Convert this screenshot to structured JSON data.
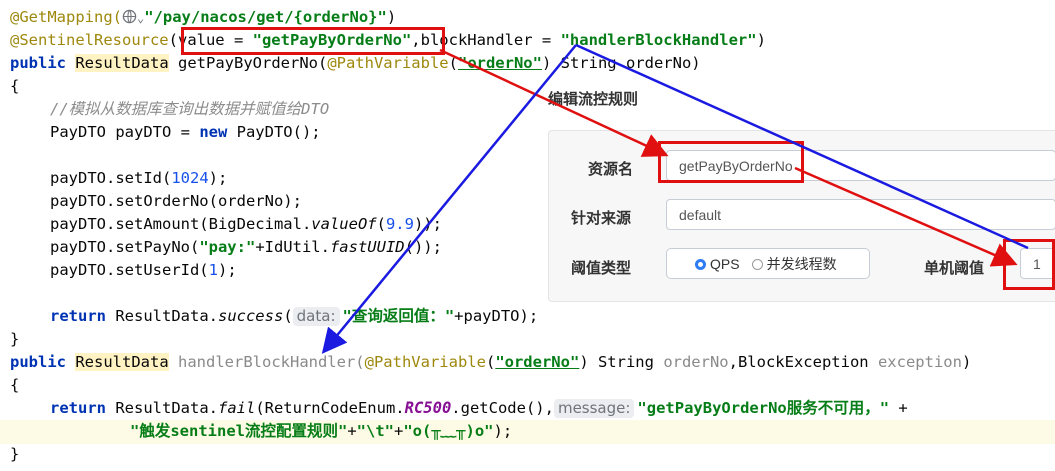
{
  "code": {
    "l1": {
      "annotation": "@GetMapping(",
      "path": "\"/pay/nacos/get/{orderNo}\"",
      "close": ")"
    },
    "l2": {
      "annotation": "@SentinelResource",
      "open": "(",
      "value_kw": "value = ",
      "value_str": "\"getPayByOrderNo\"",
      "mid": ",blockHandler = ",
      "handler_str": "\"handlerBlockHandler\"",
      "close": ")"
    },
    "l3": {
      "kw": "public",
      "type": "ResultData",
      "method": " getPayByOrderNo(",
      "anno": "@PathVariable",
      "p_open": "(",
      "p_str": "\"orderNo\"",
      "rest": ") String orderNo)"
    },
    "l4": "{",
    "l5": "//模拟从数据库查询出数据并赋值给DTO",
    "l6": {
      "a": "PayDTO payDTO = ",
      "kw": "new",
      "b": " PayDTO();"
    },
    "l7": {
      "a": "payDTO.setId(",
      "num": "1024",
      "b": ");"
    },
    "l8": "payDTO.setOrderNo(orderNo);",
    "l9": {
      "a": "payDTO.setAmount(BigDecimal.",
      "it": "valueOf",
      "b": "(",
      "num": "9.9",
      "c": "));"
    },
    "l10": {
      "a": "payDTO.setPayNo(",
      "str": "\"pay:\"",
      "b": "+IdUtil.",
      "it": "fastUUID",
      "c": "());"
    },
    "l11": {
      "a": "payDTO.setUserId(",
      "num": "1",
      "b": ");"
    },
    "l12": {
      "kw": "return",
      "a": " ResultData.",
      "it": "success",
      "b": "(",
      "hint": "data:",
      "str": "\"查询返回值：\"",
      "c": "+payDTO);"
    },
    "l13": "}",
    "l14": {
      "kw": "public",
      "type": "ResultData",
      "method": " handlerBlockHandler(",
      "anno": "@PathVariable",
      "p_open": "(",
      "p_str": "\"orderNo\"",
      "a": ") String ",
      "g1": "orderNo",
      "b": ",BlockException ",
      "g2": "exception",
      "c": ")"
    },
    "l15": "{",
    "l16": {
      "kw": "return",
      "a": " ResultData.",
      "it": "fail",
      "b": "(ReturnCodeEnum.",
      "const": "RC500",
      "c": ".getCode(),",
      "hint": "message:",
      "str": "\"getPayByOrderNo服务不可用，\"",
      "d": " +"
    },
    "l17": {
      "str1": "\"触发sentinel流控配置规则\"",
      "a": "+",
      "str2": "\"\\t\"",
      "b": "+",
      "str3": "\"o(╥﹏╥)o\"",
      "c": ");"
    },
    "l18": "}"
  },
  "dialog": {
    "title": "编辑流控规则",
    "resource_label": "资源名",
    "resource_value": "getPayByOrderNo",
    "origin_label": "针对来源",
    "origin_value": "default",
    "threshold_type_label": "阈值类型",
    "threshold_type_options": [
      "QPS",
      "并发线程数"
    ],
    "threshold_type_selected": "QPS",
    "single_threshold_label": "单机阈值",
    "single_threshold_value": "1"
  },
  "colors": {
    "keyword": "#0033b3",
    "annotation": "#9e880d",
    "string": "#067d17",
    "comment": "#8c8c8c",
    "number": "#1750eb",
    "red_callout": "#e01010",
    "blue_arrow": "#1a1ae0"
  }
}
